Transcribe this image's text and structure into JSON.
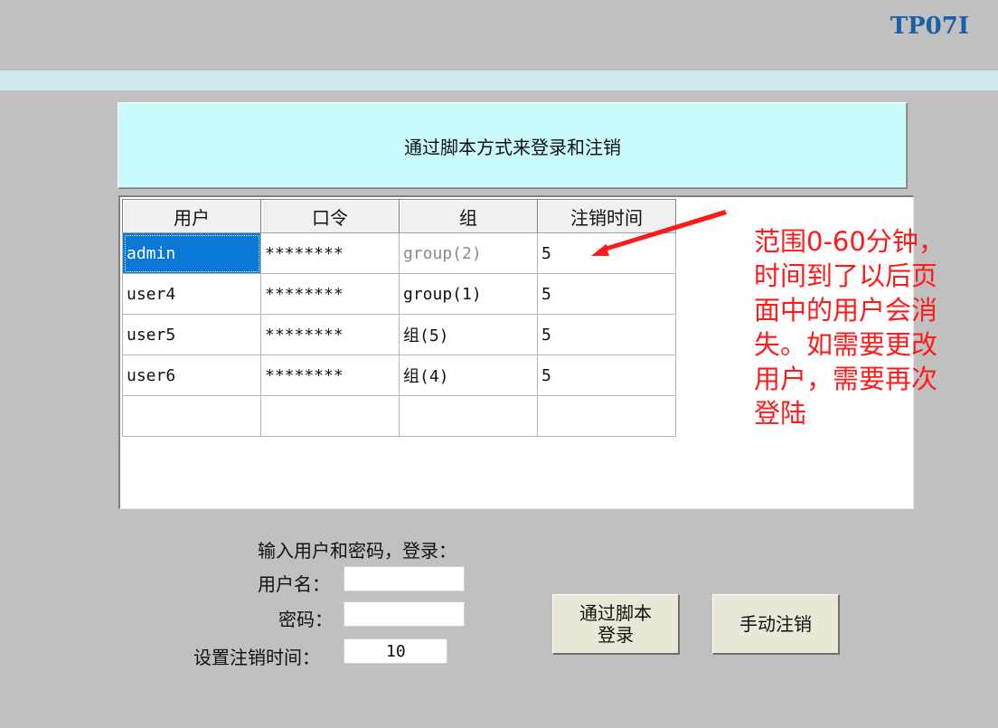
{
  "header": {
    "device_id": "TP07I"
  },
  "banner": {
    "title": "通过脚本方式来登录和注销"
  },
  "table": {
    "columns": [
      "用户",
      "口令",
      "组",
      "注销时间"
    ],
    "rows": [
      [
        "admin",
        "********",
        "group(2)",
        "5"
      ],
      [
        "user4",
        "********",
        "group(1)",
        "5"
      ],
      [
        "user5",
        "********",
        "组(5)",
        "5"
      ],
      [
        "user6",
        "********",
        "组(4)",
        "5"
      ],
      [
        "",
        "",
        "",
        ""
      ]
    ]
  },
  "annotation": {
    "lines": [
      "范围0-60分钟，",
      "时间到了以后页",
      "面中的用户会消",
      "失。如需要更改",
      "用户，需要再次",
      "登陆"
    ],
    "color": "#ff1a1a"
  },
  "login": {
    "prompt": "输入用户和密码，登录：",
    "username_label": "用户名：",
    "username_value": "",
    "password_label": "密码：",
    "password_value": "",
    "logout_time_label": "设置注销时间：",
    "logout_time_value": "10"
  },
  "buttons": {
    "script_login_line1": "通过脚本",
    "script_login_line2": "登录",
    "manual_logout": "手动注销"
  },
  "colors": {
    "background": "#c0c0c0",
    "banner": "#c9fbfd",
    "selected_cell": "#0a78d7",
    "title": "#1b5fa6"
  }
}
